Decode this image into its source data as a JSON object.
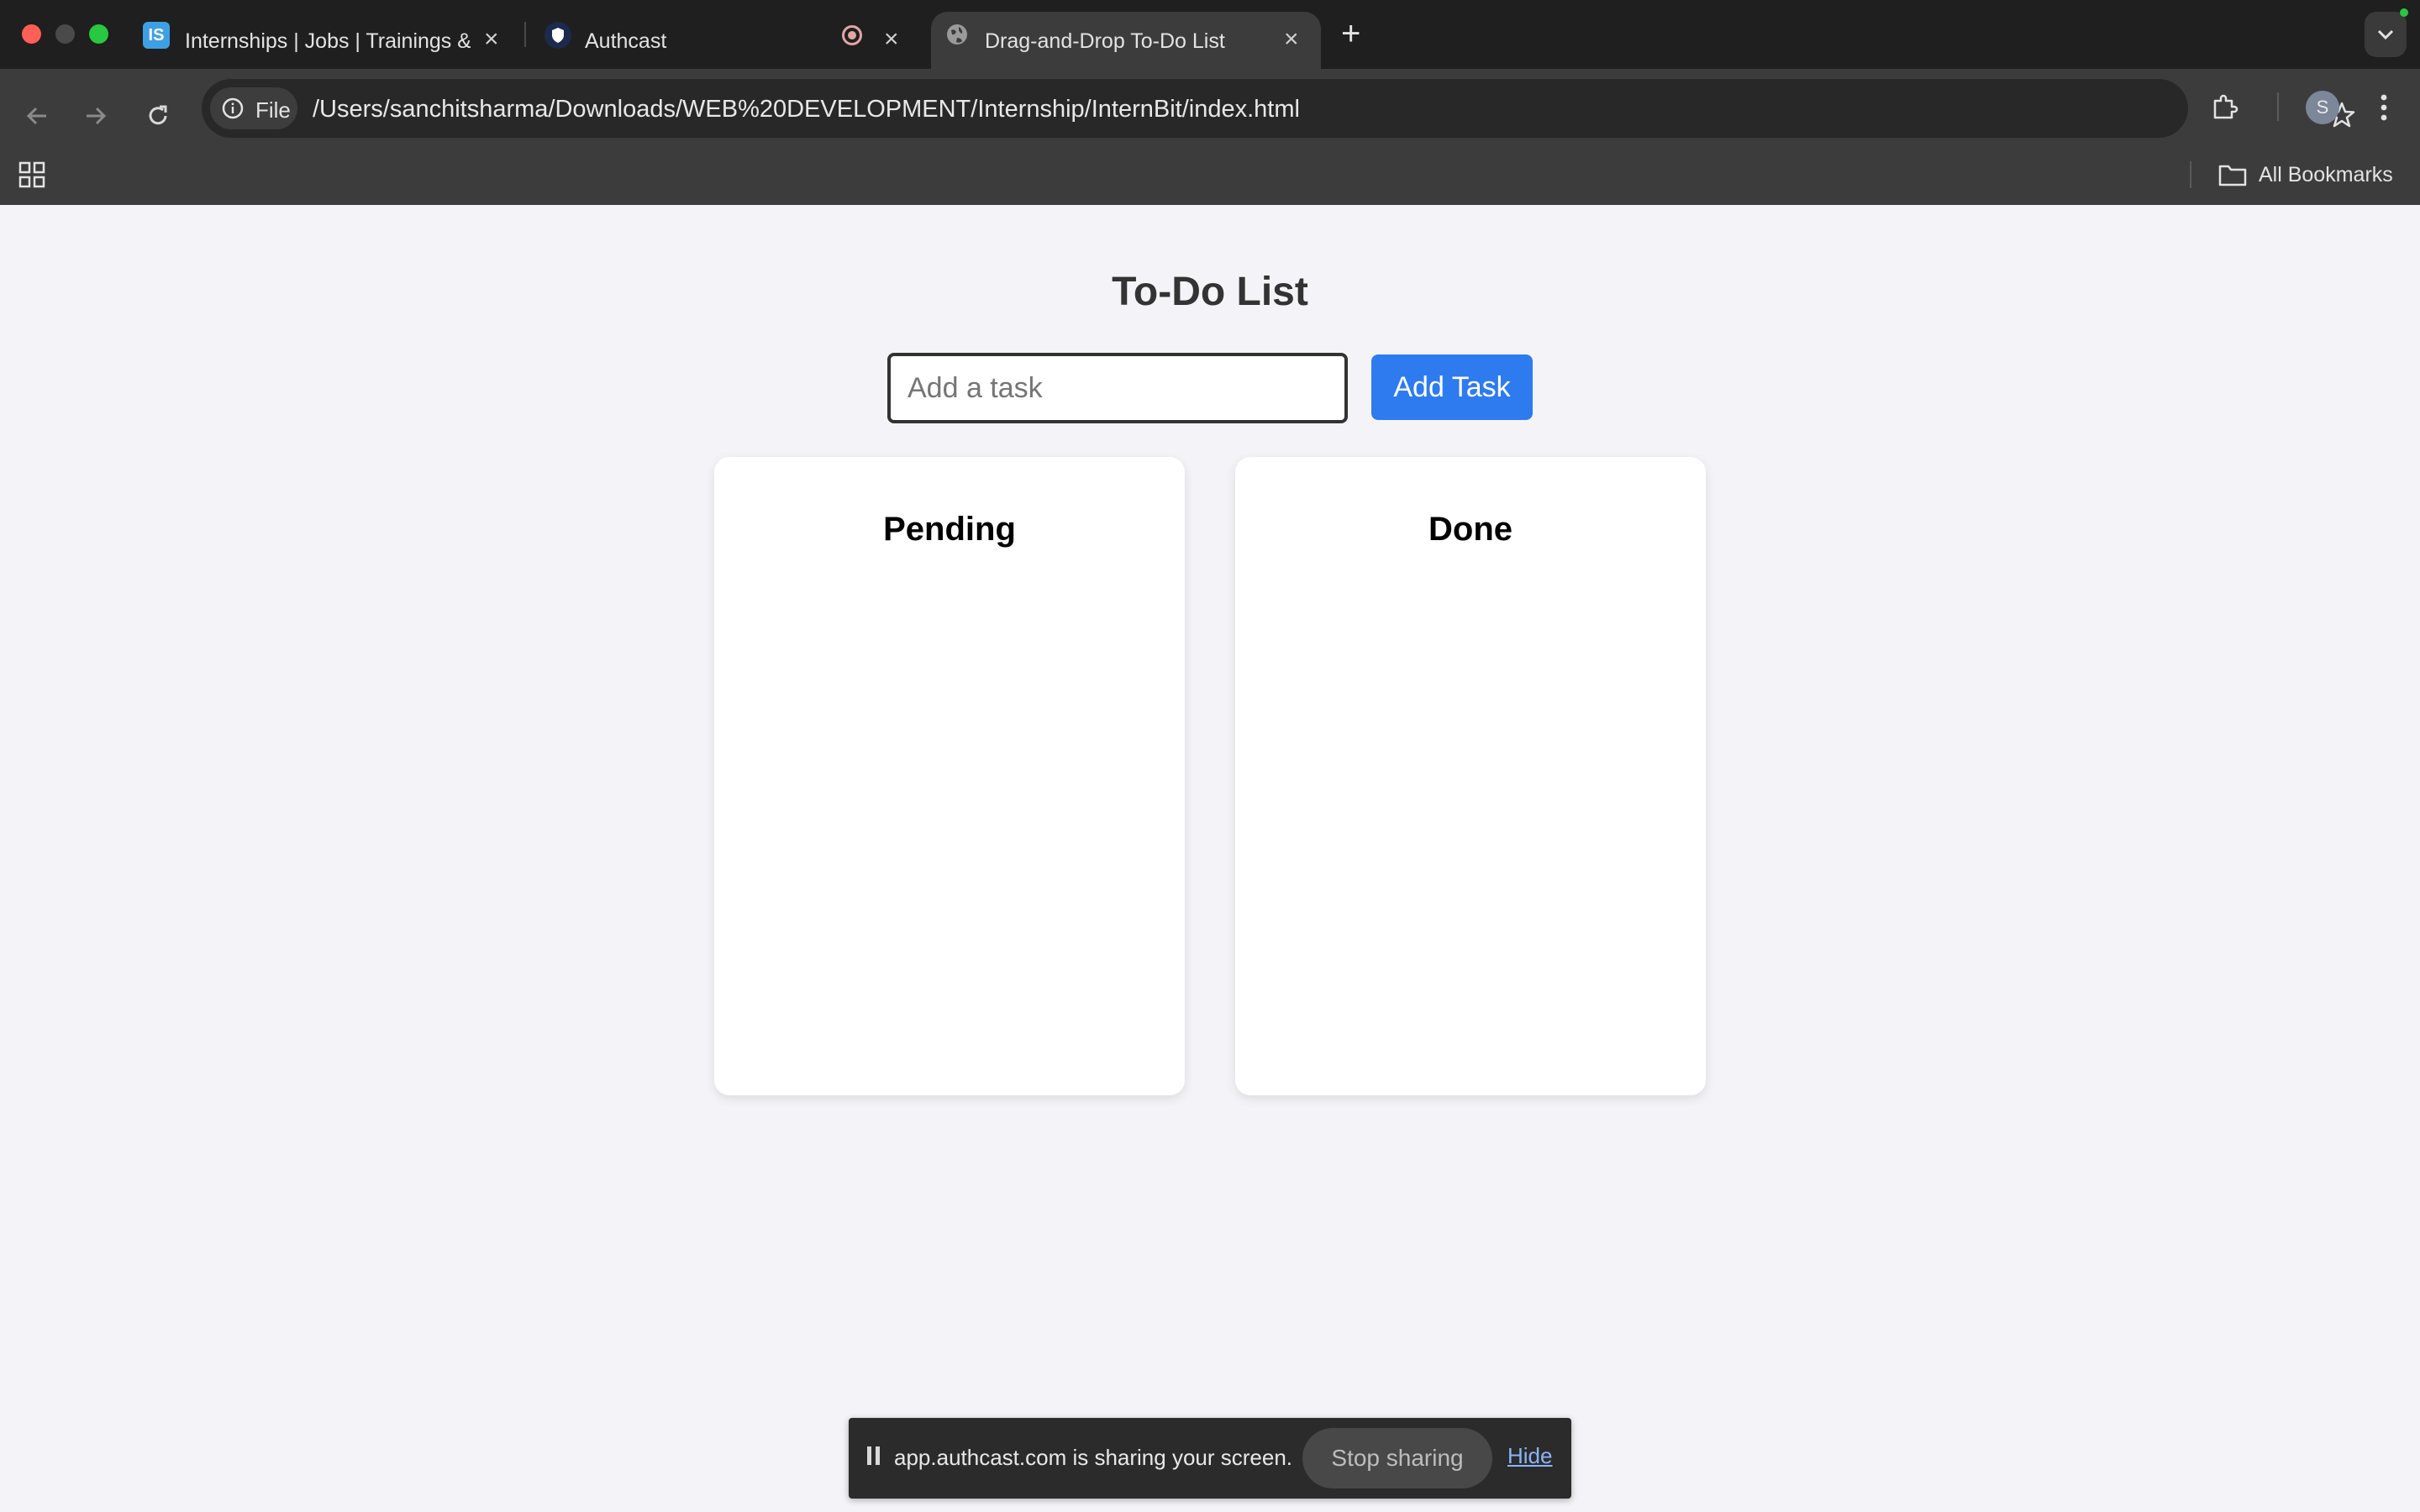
{
  "browser": {
    "tabs": [
      {
        "title": "Internships | Jobs | Trainings & ...",
        "favicon": "IS",
        "active": false
      },
      {
        "title": "Authcast",
        "favicon": "shield-icon",
        "active": false,
        "recording": true
      },
      {
        "title": "Drag-and-Drop To-Do List",
        "favicon": "globe-icon",
        "active": true
      }
    ],
    "address": {
      "chip_label": "File",
      "url": "/Users/sanchitsharma/Downloads/WEB%20DEVELOPMENT/Internship/InternBit/index.html"
    },
    "profile_initial": "S",
    "bookmarks_label": "All Bookmarks"
  },
  "page": {
    "title": "To-Do List",
    "input_placeholder": "Add a task",
    "add_button_label": "Add Task",
    "columns": [
      {
        "title": "Pending"
      },
      {
        "title": "Done"
      }
    ]
  },
  "share_banner": {
    "message": "app.authcast.com is sharing your screen.",
    "stop_label": "Stop sharing",
    "hide_label": "Hide"
  },
  "colors": {
    "accent": "#2e7bf0",
    "page_bg": "#f4f4f8",
    "chrome_dark": "#1f1f1f",
    "chrome_toolbar": "#3c3c3c"
  }
}
